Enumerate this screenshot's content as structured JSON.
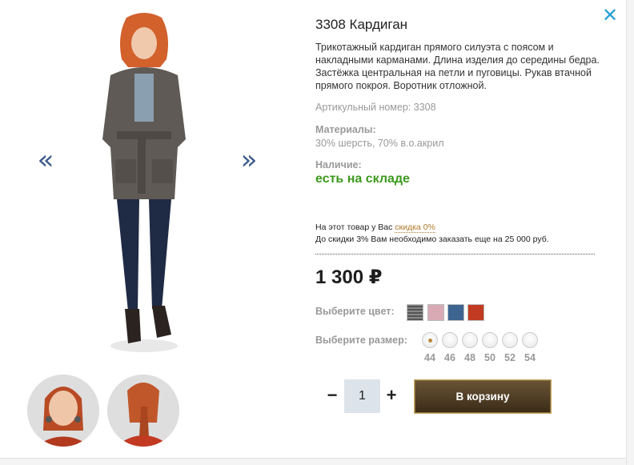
{
  "product": {
    "title": "3308 Кардиган",
    "description": "Трикотажный кардиган прямого силуэта с поясом и накладными карманами. Длина изделия до середины бедра. Застёжка центральная на петли и пуговицы. Рукав втачной прямого покроя. Воротник отложной.",
    "article": "Артикульный номер: 3308",
    "materials_label": "Материалы:",
    "materials_value": "30% шерсть, 70% в.о.акрил",
    "stock_label": "Наличие:",
    "stock_value": "есть на складе",
    "price": "1 300 ₽"
  },
  "discount": {
    "line1_prefix": "На этот товар у Вас ",
    "link": "скидка 0%",
    "line2": "До скидки 3% Вам необходимо заказать еще на 25 000 руб."
  },
  "colors": {
    "label": "Выберите цвет:",
    "swatches": [
      "#7a7a7a",
      "#d9a9b4",
      "#3e6491",
      "#c23a22"
    ]
  },
  "sizes": {
    "label": "Выберите размер:",
    "options": [
      "44",
      "46",
      "48",
      "50",
      "52",
      "54"
    ],
    "selected": "44"
  },
  "cart": {
    "quantity": "1",
    "minus": "−",
    "plus": "+",
    "button": "В корзину"
  },
  "gallery": {
    "prev": "«",
    "next": "»",
    "close": "✕"
  },
  "icons": {
    "close": "close-icon",
    "prev": "chevron-left-icon",
    "next": "chevron-right-icon"
  }
}
